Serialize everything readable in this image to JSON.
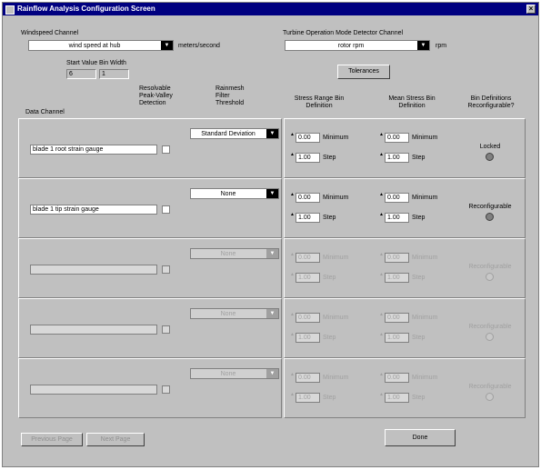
{
  "window": {
    "title": "Rainflow Analysis Configuration Screen",
    "close_glyph": "×"
  },
  "top": {
    "wind_label": "Windspeed Channel",
    "wind_value": "wind speed at hub",
    "wind_units": "meters/second",
    "start_label": "Start Value",
    "start_value": "6",
    "bin_label": "Bin Width",
    "bin_value": "1",
    "turbine_label": "Turbine Operation Mode Detector Channel",
    "turbine_value": "rotor rpm",
    "turbine_units": "rpm",
    "tolerances_label": "Tolerances"
  },
  "headers": {
    "data_channel": "Data Channel",
    "peak": "Resolvable Peak-Valley Detection",
    "filter": "Rainmesh Filter Threshold",
    "range": "Stress Range Bin Definition",
    "mean": "Mean Stress Bin Definition",
    "bindef": "Bin Definitions Reconfigurable?"
  },
  "labels": {
    "minimum": "Minimum",
    "step": "Step",
    "spin": "▲▼"
  },
  "rows": [
    {
      "channel": "blade 1 root strain gauge",
      "filter": "Standard Deviation",
      "range_min": "0.00",
      "range_step": "1.00",
      "mean_min": "0.00",
      "mean_step": "1.00",
      "status": "Locked",
      "enabled": true
    },
    {
      "channel": "blade 1 tip strain gauge",
      "filter": "None",
      "range_min": "0.00",
      "range_step": "1.00",
      "mean_min": "0.00",
      "mean_step": "1.00",
      "status": "Reconfigurable",
      "enabled": true
    },
    {
      "channel": "",
      "filter": "None",
      "range_min": "0.00",
      "range_step": "1.00",
      "mean_min": "0.00",
      "mean_step": "1.00",
      "status": "Reconfigurable",
      "enabled": false
    },
    {
      "channel": "",
      "filter": "None",
      "range_min": "0.00",
      "range_step": "1.00",
      "mean_min": "0.00",
      "mean_step": "1.00",
      "status": "Reconfigurable",
      "enabled": false
    },
    {
      "channel": "",
      "filter": "None",
      "range_min": "0.00",
      "range_step": "1.00",
      "mean_min": "0.00",
      "mean_step": "1.00",
      "status": "Reconfigurable",
      "enabled": false
    }
  ],
  "footer": {
    "prev": "Previous Page",
    "next": "Next Page",
    "done": "Done"
  }
}
